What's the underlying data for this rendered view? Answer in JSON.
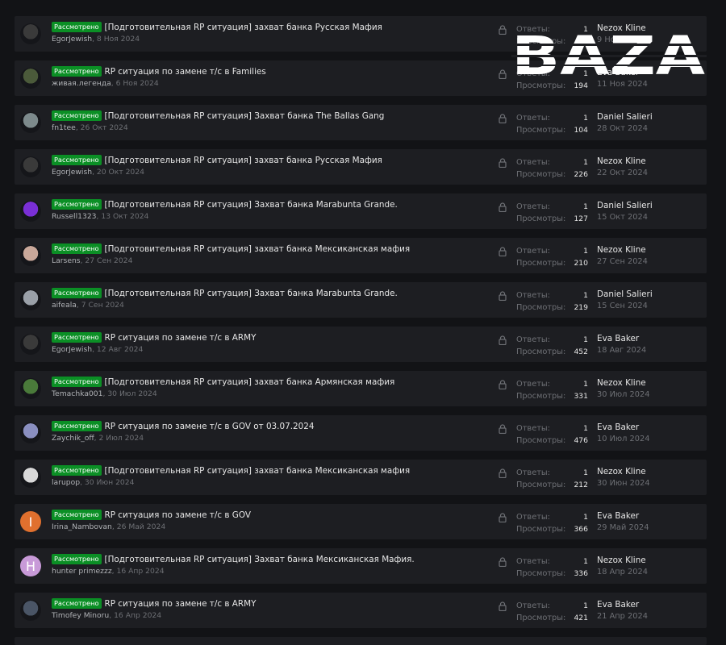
{
  "status_badge": "Рассмотрено",
  "replies_label": "Ответы:",
  "views_label": "Просмотры:",
  "watermark": "BAZA",
  "threads": [
    {
      "title": "[Подготовительная RP ситуация] захват банка Русская Мафия",
      "author": "EgorJewish",
      "date": "8 Ноя 2024",
      "replies": "1",
      "views": "",
      "last_user": "Nezox Kline",
      "last_date": "9 Ноя 2024",
      "avatar": {
        "type": "img",
        "color": "#3a3a3a"
      }
    },
    {
      "title": "RP ситуация по замене т/с в Families",
      "author": "живая.легенда",
      "date": "6 Ноя 2024",
      "replies": "1",
      "views": "194",
      "last_user": "Eva Baker",
      "last_date": "11 Ноя 2024",
      "avatar": {
        "type": "img",
        "color": "#4b5a3a"
      }
    },
    {
      "title": "[Подготовительная RP ситуация] Захват банка The Ballas Gang",
      "author": "fn1tee",
      "date": "26 Окт 2024",
      "replies": "1",
      "views": "104",
      "last_user": "Daniel Salieri",
      "last_date": "28 Окт 2024",
      "avatar": {
        "type": "img",
        "color": "#7d8a8c"
      }
    },
    {
      "title": "[Подготовительная RP ситуация] захват банка Русская Мафия",
      "author": "EgorJewish",
      "date": "20 Окт 2024",
      "replies": "1",
      "views": "226",
      "last_user": "Nezox Kline",
      "last_date": "22 Окт 2024",
      "avatar": {
        "type": "img",
        "color": "#3a3a3a"
      }
    },
    {
      "title": "[Подготовительная RP ситуация] Захват банка Marabunta Grande.",
      "author": "Russell1323",
      "date": "13 Окт 2024",
      "replies": "1",
      "views": "127",
      "last_user": "Daniel Salieri",
      "last_date": "15 Окт 2024",
      "avatar": {
        "type": "img",
        "color": "#7a2fd6"
      }
    },
    {
      "title": "[Подготовительная RP ситуация] захват банка Мексиканская мафия",
      "author": "Larsens",
      "date": "27 Сен 2024",
      "replies": "1",
      "views": "210",
      "last_user": "Nezox Kline",
      "last_date": "27 Сен 2024",
      "avatar": {
        "type": "img",
        "color": "#c9a89a"
      }
    },
    {
      "title": "[Подготовительная RP ситуация] Захват банка Marabunta Grande.",
      "author": "aifeala",
      "date": "7 Сен 2024",
      "replies": "1",
      "views": "219",
      "last_user": "Daniel Salieri",
      "last_date": "15 Сен 2024",
      "avatar": {
        "type": "img",
        "color": "#9aa0a8"
      }
    },
    {
      "title": "RP ситуация по замене т/с в ARMY",
      "author": "EgorJewish",
      "date": "12 Авг 2024",
      "replies": "1",
      "views": "452",
      "last_user": "Eva Baker",
      "last_date": "18 Авг 2024",
      "avatar": {
        "type": "img",
        "color": "#3a3a3a"
      }
    },
    {
      "title": "[Подготовительная RP ситуация] захват банка Армянская мафия",
      "author": "Temachka001",
      "date": "30 Июл 2024",
      "replies": "1",
      "views": "331",
      "last_user": "Nezox Kline",
      "last_date": "30 Июл 2024",
      "avatar": {
        "type": "img",
        "color": "#4a7a3a"
      }
    },
    {
      "title": "RP ситуация по замене т/с в GOV от 03.07.2024",
      "author": "Zaychik_off",
      "date": "2 Июл 2024",
      "replies": "1",
      "views": "476",
      "last_user": "Eva Baker",
      "last_date": "10 Июл 2024",
      "avatar": {
        "type": "img",
        "color": "#8a8fc0"
      }
    },
    {
      "title": "[Подготовительная RP ситуация] захват банка Мексиканская мафия",
      "author": "larupop",
      "date": "30 Июн 2024",
      "replies": "1",
      "views": "212",
      "last_user": "Nezox Kline",
      "last_date": "30 Июн 2024",
      "avatar": {
        "type": "img",
        "color": "#d8d8d8"
      }
    },
    {
      "title": "RP ситуация по замене т/с в GOV",
      "author": "Irina_Nambovan",
      "date": "26 Май 2024",
      "replies": "1",
      "views": "366",
      "last_user": "Eva Baker",
      "last_date": "29 Май 2024",
      "avatar": {
        "type": "letter",
        "letter": "I",
        "color": "#e0702e"
      }
    },
    {
      "title": "[Подготовительная RP ситуация] Захват банка Мексиканская Мафия.",
      "author": "hunter primezzz",
      "date": "16 Апр 2024",
      "replies": "1",
      "views": "336",
      "last_user": "Nezox Kline",
      "last_date": "18 Апр 2024",
      "avatar": {
        "type": "letter",
        "letter": "H",
        "color": "#c89ad8"
      }
    },
    {
      "title": "RP ситуация по замене т/с в ARMY",
      "author": "Timofey Minoru",
      "date": "16 Апр 2024",
      "replies": "1",
      "views": "421",
      "last_user": "Eva Baker",
      "last_date": "21 Апр 2024",
      "avatar": {
        "type": "img",
        "color": "#4a5566"
      }
    }
  ]
}
